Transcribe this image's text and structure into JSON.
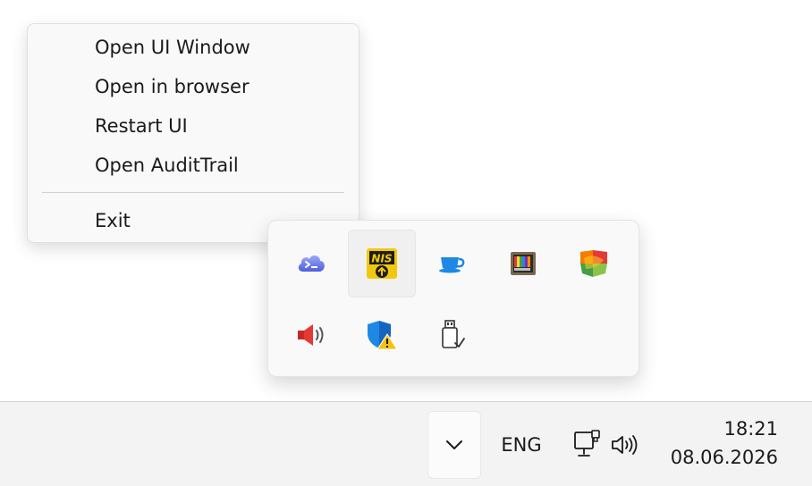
{
  "context_menu": {
    "items": [
      {
        "label": "Open UI Window"
      },
      {
        "label": "Open in browser"
      },
      {
        "label": "Restart UI"
      },
      {
        "label": "Open AuditTrail"
      }
    ],
    "exit_label": "Exit"
  },
  "tray_overflow": {
    "icons": [
      {
        "name": "terminal-cloud-icon"
      },
      {
        "name": "nis-update-icon",
        "label": "NIS"
      },
      {
        "name": "coffee-cup-icon"
      },
      {
        "name": "color-bars-monitor-icon"
      },
      {
        "name": "colorful-shield-icon"
      },
      {
        "name": "speaker-icon"
      },
      {
        "name": "security-warning-shield-icon"
      },
      {
        "name": "usb-safely-remove-icon"
      }
    ]
  },
  "taskbar": {
    "language": "ENG",
    "time": "18:21",
    "date": "08.06.2026"
  },
  "colors": {
    "accent_blue": "#1e88e5",
    "warning_yellow": "#f5c211",
    "nis_yellow": "#f2c80f"
  }
}
